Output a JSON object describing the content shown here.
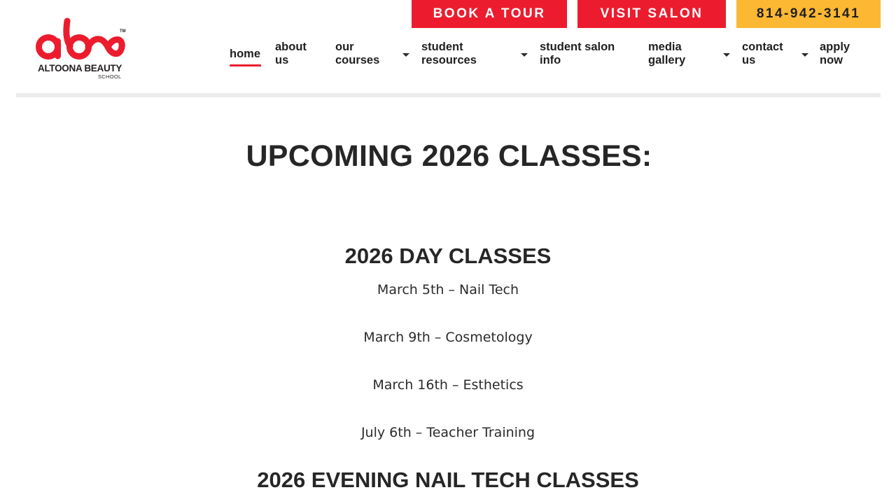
{
  "header": {
    "logo": {
      "mark": "abs",
      "name": "ALTOONA BEAUTY",
      "sub": "SCHOOL",
      "tm": "TM"
    },
    "cta": {
      "tour": "BOOK A TOUR",
      "salon": "VISIT SALON",
      "phone": "814-942-3141"
    },
    "nav": [
      {
        "line1": "home",
        "line2": "",
        "active": true,
        "dropdown": false
      },
      {
        "line1": "about",
        "line2": "us",
        "active": false,
        "dropdown": false
      },
      {
        "line1": "our",
        "line2": "courses",
        "active": false,
        "dropdown": true
      },
      {
        "line1": "student",
        "line2": "resources",
        "active": false,
        "dropdown": true
      },
      {
        "line1": "student salon",
        "line2": "info",
        "active": false,
        "dropdown": false
      },
      {
        "line1": "media",
        "line2": "gallery",
        "active": false,
        "dropdown": true
      },
      {
        "line1": "contact",
        "line2": "us",
        "active": false,
        "dropdown": true
      },
      {
        "line1": "apply",
        "line2": "now",
        "active": false,
        "dropdown": false
      }
    ]
  },
  "main": {
    "title": "UPCOMING 2026 CLASSES:",
    "day_heading": "2026 DAY CLASSES",
    "day_classes": [
      "March 5th – Nail Tech",
      "March 9th – Cosmetology",
      "March 16th – Esthetics",
      "July 6th – Teacher Training"
    ],
    "evening_heading": "2026 EVENING NAIL TECH CLASSES"
  },
  "colors": {
    "brand_red": "#ec1c2e",
    "accent_yellow": "#fdb833",
    "text_dark": "#262626",
    "rule_gray": "#ececec"
  }
}
